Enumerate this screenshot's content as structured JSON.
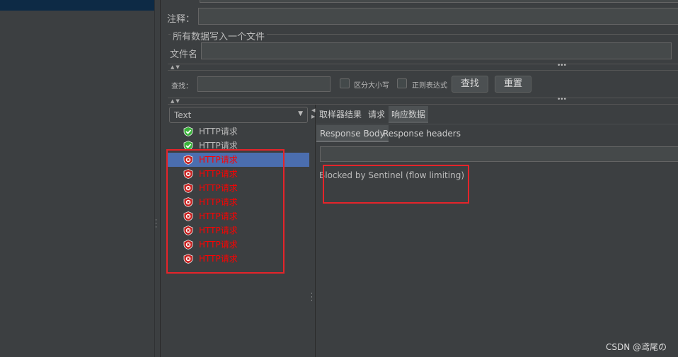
{
  "form": {
    "comment_label": "注释：",
    "section_title": "所有数据写入一个文件",
    "filename_label": "文件名"
  },
  "search": {
    "label": "查找：",
    "case_label": "区分大小写",
    "regex_label": "正则表达式",
    "find_button": "查找",
    "reset_button": "重置"
  },
  "tree": {
    "renderer": "Text",
    "items": [
      {
        "label": "HTTP请求",
        "status": "success",
        "icon": "shield-check-icon"
      },
      {
        "label": "HTTP请求",
        "status": "success",
        "icon": "shield-check-icon"
      },
      {
        "label": "HTTP请求",
        "status": "error",
        "icon": "shield-x-icon",
        "selected": true
      },
      {
        "label": "HTTP请求",
        "status": "error",
        "icon": "shield-x-icon"
      },
      {
        "label": "HTTP请求",
        "status": "error",
        "icon": "shield-x-icon"
      },
      {
        "label": "HTTP请求",
        "status": "error",
        "icon": "shield-x-icon"
      },
      {
        "label": "HTTP请求",
        "status": "error",
        "icon": "shield-x-icon"
      },
      {
        "label": "HTTP请求",
        "status": "error",
        "icon": "shield-x-icon"
      },
      {
        "label": "HTTP请求",
        "status": "error",
        "icon": "shield-x-icon"
      },
      {
        "label": "HTTP请求",
        "status": "error",
        "icon": "shield-x-icon"
      }
    ]
  },
  "result_tabs": [
    {
      "label": "取样器结果"
    },
    {
      "label": "请求"
    },
    {
      "label": "响应数据",
      "active": true
    }
  ],
  "response_tabs": [
    {
      "label": "Response Body",
      "active": true
    },
    {
      "label": "Response headers"
    }
  ],
  "response_body": "Blocked by Sentinel (flow limiting)",
  "watermark": "CSDN @鸢尾の",
  "colors": {
    "background": "#3c3f41",
    "selection": "#4b6eaf",
    "error": "#ff0000",
    "annotation": "#e5242a",
    "success": "#3bb33b"
  }
}
